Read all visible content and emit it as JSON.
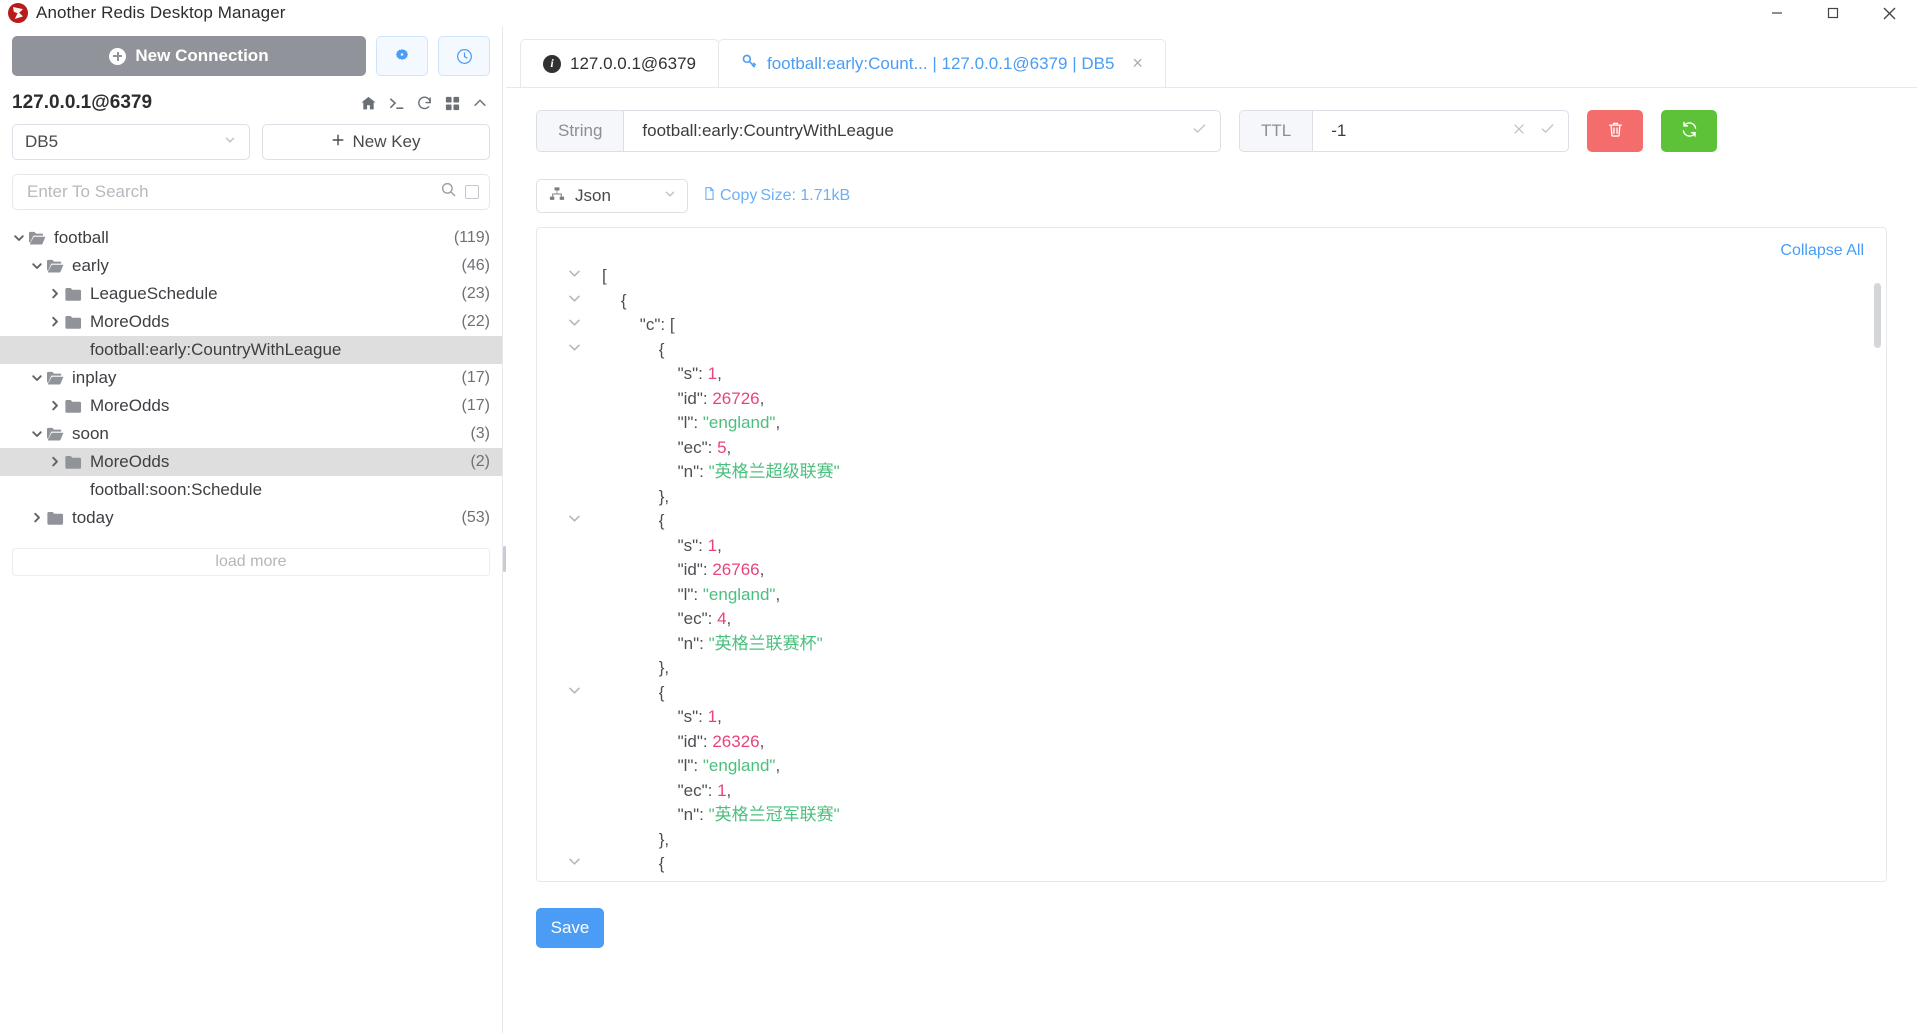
{
  "window": {
    "title": "Another Redis Desktop Manager",
    "logo_icon": "redis-logo-icon",
    "minimize_icon": "minimize-icon",
    "maximize_icon": "maximize-icon",
    "close_icon": "close-icon"
  },
  "sidebar": {
    "new_connection_label": "New Connection",
    "settings_icon": "settings-gear-icon",
    "history_icon": "clock-history-icon",
    "connection_name": "127.0.0.1@6379",
    "tools": [
      {
        "icon": "home-icon",
        "name": "home-icon"
      },
      {
        "icon": "console-icon",
        "name": "console-icon"
      },
      {
        "icon": "refresh-icon",
        "name": "refresh-icon"
      },
      {
        "icon": "grid-icon",
        "name": "grid-view-icon"
      },
      {
        "icon": "collapse-icon",
        "name": "collapse-up-icon"
      }
    ],
    "db_selected": "DB5",
    "new_key_label": "New Key",
    "search_placeholder": "Enter To Search",
    "search_value": "",
    "search_icon": "search-icon",
    "load_more_label": "load more",
    "tree": [
      {
        "label": "football",
        "count": "(119)",
        "depth": 0,
        "arrow": "down",
        "icon": "folder-open-icon",
        "selected": false
      },
      {
        "label": "early",
        "count": "(46)",
        "depth": 1,
        "arrow": "down",
        "icon": "folder-open-icon",
        "selected": false
      },
      {
        "label": "LeagueSchedule",
        "count": "(23)",
        "depth": 2,
        "arrow": "right",
        "icon": "folder-icon",
        "selected": false
      },
      {
        "label": "MoreOdds",
        "count": "(22)",
        "depth": 2,
        "arrow": "right",
        "icon": "folder-icon",
        "selected": false
      },
      {
        "label": "football:early:CountryWithLeague",
        "count": "",
        "depth": 2,
        "arrow": "none",
        "icon": "none",
        "selected": true
      },
      {
        "label": "inplay",
        "count": "(17)",
        "depth": 1,
        "arrow": "down",
        "icon": "folder-open-icon",
        "selected": false
      },
      {
        "label": "MoreOdds",
        "count": "(17)",
        "depth": 2,
        "arrow": "right",
        "icon": "folder-icon",
        "selected": false
      },
      {
        "label": "soon",
        "count": "(3)",
        "depth": 1,
        "arrow": "down",
        "icon": "folder-open-icon",
        "selected": false
      },
      {
        "label": "MoreOdds",
        "count": "(2)",
        "depth": 2,
        "arrow": "right",
        "icon": "folder-icon",
        "selected": true
      },
      {
        "label": "football:soon:Schedule",
        "count": "",
        "depth": 2,
        "arrow": "none",
        "icon": "none",
        "selected": false
      },
      {
        "label": "today",
        "count": "(53)",
        "depth": 1,
        "arrow": "right",
        "icon": "folder-icon",
        "selected": false
      }
    ]
  },
  "tabs": [
    {
      "label": "127.0.0.1@6379",
      "icon": "info-icon",
      "active": false,
      "closable": false
    },
    {
      "label": "football:early:Count... | 127.0.0.1@6379 | DB5",
      "icon": "key-icon",
      "active": true,
      "closable": true,
      "close_label": "×"
    }
  ],
  "key_toolbar": {
    "type_label": "String",
    "key_value": "football:early:CountryWithLeague",
    "key_check_icon": "check-icon",
    "ttl_label": "TTL",
    "ttl_value": "-1",
    "ttl_clear_icon": "clear-x-icon",
    "ttl_check_icon": "check-icon",
    "delete_icon": "trash-icon",
    "refresh_icon": "refresh-icon"
  },
  "format_row": {
    "format_icon": "tree-structure-icon",
    "format_selected": "Json",
    "copy_icon": "copy-document-icon",
    "copy_label": "Copy",
    "size_label": "Size: 1.71kB"
  },
  "viewer": {
    "collapse_all_label": "Collapse All",
    "lines": [
      {
        "gutter": "down",
        "indent": 0,
        "parts": [
          {
            "t": "[",
            "c": "jpunct"
          }
        ]
      },
      {
        "gutter": "down",
        "indent": 1,
        "parts": [
          {
            "t": "{",
            "c": "jpunct"
          }
        ]
      },
      {
        "gutter": "down",
        "indent": 2,
        "parts": [
          {
            "t": "\"c\": [",
            "c": "jkey"
          }
        ]
      },
      {
        "gutter": "down",
        "indent": 3,
        "parts": [
          {
            "t": "{",
            "c": "jpunct"
          }
        ]
      },
      {
        "gutter": "none",
        "indent": 4,
        "parts": [
          {
            "t": "\"s\": ",
            "c": "jkey"
          },
          {
            "t": "1",
            "c": "jnum"
          },
          {
            "t": ",",
            "c": "jpunct"
          }
        ]
      },
      {
        "gutter": "none",
        "indent": 4,
        "parts": [
          {
            "t": "\"id\": ",
            "c": "jkey"
          },
          {
            "t": "26726",
            "c": "jnum"
          },
          {
            "t": ",",
            "c": "jpunct"
          }
        ]
      },
      {
        "gutter": "none",
        "indent": 4,
        "parts": [
          {
            "t": "\"l\": ",
            "c": "jkey"
          },
          {
            "t": "\"england\"",
            "c": "jstr"
          },
          {
            "t": ",",
            "c": "jpunct"
          }
        ]
      },
      {
        "gutter": "none",
        "indent": 4,
        "parts": [
          {
            "t": "\"ec\": ",
            "c": "jkey"
          },
          {
            "t": "5",
            "c": "jnum"
          },
          {
            "t": ",",
            "c": "jpunct"
          }
        ]
      },
      {
        "gutter": "none",
        "indent": 4,
        "parts": [
          {
            "t": "\"n\": ",
            "c": "jkey"
          },
          {
            "t": "\"英格兰超级联赛\"",
            "c": "jstr"
          }
        ]
      },
      {
        "gutter": "none",
        "indent": 3,
        "parts": [
          {
            "t": "},",
            "c": "jpunct"
          }
        ]
      },
      {
        "gutter": "down",
        "indent": 3,
        "parts": [
          {
            "t": "{",
            "c": "jpunct"
          }
        ]
      },
      {
        "gutter": "none",
        "indent": 4,
        "parts": [
          {
            "t": "\"s\": ",
            "c": "jkey"
          },
          {
            "t": "1",
            "c": "jnum"
          },
          {
            "t": ",",
            "c": "jpunct"
          }
        ]
      },
      {
        "gutter": "none",
        "indent": 4,
        "parts": [
          {
            "t": "\"id\": ",
            "c": "jkey"
          },
          {
            "t": "26766",
            "c": "jnum"
          },
          {
            "t": ",",
            "c": "jpunct"
          }
        ]
      },
      {
        "gutter": "none",
        "indent": 4,
        "parts": [
          {
            "t": "\"l\": ",
            "c": "jkey"
          },
          {
            "t": "\"england\"",
            "c": "jstr"
          },
          {
            "t": ",",
            "c": "jpunct"
          }
        ]
      },
      {
        "gutter": "none",
        "indent": 4,
        "parts": [
          {
            "t": "\"ec\": ",
            "c": "jkey"
          },
          {
            "t": "4",
            "c": "jnum"
          },
          {
            "t": ",",
            "c": "jpunct"
          }
        ]
      },
      {
        "gutter": "none",
        "indent": 4,
        "parts": [
          {
            "t": "\"n\": ",
            "c": "jkey"
          },
          {
            "t": "\"英格兰联赛杯\"",
            "c": "jstr"
          }
        ]
      },
      {
        "gutter": "none",
        "indent": 3,
        "parts": [
          {
            "t": "},",
            "c": "jpunct"
          }
        ]
      },
      {
        "gutter": "down",
        "indent": 3,
        "parts": [
          {
            "t": "{",
            "c": "jpunct"
          }
        ]
      },
      {
        "gutter": "none",
        "indent": 4,
        "parts": [
          {
            "t": "\"s\": ",
            "c": "jkey"
          },
          {
            "t": "1",
            "c": "jnum"
          },
          {
            "t": ",",
            "c": "jpunct"
          }
        ]
      },
      {
        "gutter": "none",
        "indent": 4,
        "parts": [
          {
            "t": "\"id\": ",
            "c": "jkey"
          },
          {
            "t": "26326",
            "c": "jnum"
          },
          {
            "t": ",",
            "c": "jpunct"
          }
        ]
      },
      {
        "gutter": "none",
        "indent": 4,
        "parts": [
          {
            "t": "\"l\": ",
            "c": "jkey"
          },
          {
            "t": "\"england\"",
            "c": "jstr"
          },
          {
            "t": ",",
            "c": "jpunct"
          }
        ]
      },
      {
        "gutter": "none",
        "indent": 4,
        "parts": [
          {
            "t": "\"ec\": ",
            "c": "jkey"
          },
          {
            "t": "1",
            "c": "jnum"
          },
          {
            "t": ",",
            "c": "jpunct"
          }
        ]
      },
      {
        "gutter": "none",
        "indent": 4,
        "parts": [
          {
            "t": "\"n\": ",
            "c": "jkey"
          },
          {
            "t": "\"英格兰冠军联赛\"",
            "c": "jstr"
          }
        ]
      },
      {
        "gutter": "none",
        "indent": 3,
        "parts": [
          {
            "t": "},",
            "c": "jpunct"
          }
        ]
      },
      {
        "gutter": "down",
        "indent": 3,
        "parts": [
          {
            "t": "{",
            "c": "jpunct"
          }
        ]
      }
    ]
  },
  "footer": {
    "save_label": "Save"
  },
  "colors": {
    "accent": "#4a9cf5",
    "danger": "#f56c6c",
    "success": "#5ec239",
    "grey_button": "#909399",
    "json_number": "#e8437d",
    "json_string": "#4bbf7e",
    "selection": "#dedede"
  }
}
